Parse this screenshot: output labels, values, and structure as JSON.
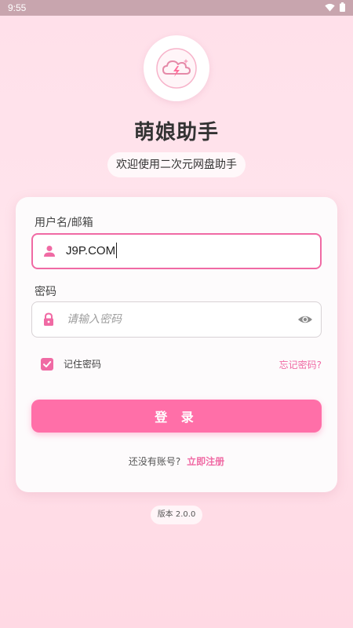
{
  "status_bar": {
    "time": "9:55",
    "icons": [
      "wifi-icon",
      "battery-icon"
    ]
  },
  "app": {
    "logo": "cloud-lightning-logo",
    "title": "萌娘助手",
    "subtitle": "欢迎使用二次元网盘助手",
    "version": "版本 2.0.0"
  },
  "login_form": {
    "username_label": "用户名/邮箱",
    "username_value": "J9P.COM",
    "username_icon": "person-icon",
    "password_label": "密码",
    "password_placeholder": "请输入密码",
    "password_icon": "lock-icon",
    "password_toggle_icon": "eye-icon",
    "remember_label": "记住密码",
    "remember_checked": true,
    "forgot_link": "忘记密码?",
    "login_button": "登 录",
    "register_prompt": "还没有账号?",
    "register_link": "立即注册"
  },
  "colors": {
    "accent": "#f06aa4",
    "button": "#ff6fa8",
    "background": "#ffe0ea",
    "status_bar": "#c8a5ae"
  }
}
